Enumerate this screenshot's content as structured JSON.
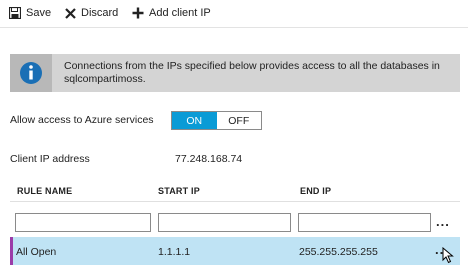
{
  "toolbar": {
    "save_label": "Save",
    "discard_label": "Discard",
    "add_client_ip_label": "Add client IP"
  },
  "info": {
    "text": "Connections from the IPs specified below provides access to all the databases in sqlcompartimoss.",
    "icon": "info-icon"
  },
  "azure_access": {
    "label": "Allow access to Azure services",
    "on_label": "ON",
    "off_label": "OFF",
    "selected": "ON"
  },
  "client_ip": {
    "label": "Client IP address",
    "value": "77.248.168.74"
  },
  "table": {
    "headers": [
      "RULE NAME",
      "START IP",
      "END IP"
    ],
    "new_rule": {
      "rule_name": "",
      "start_ip": "",
      "end_ip": "",
      "more_label": "..."
    },
    "rows": [
      {
        "rule_name": "All Open",
        "start_ip": "1.1.1.1",
        "end_ip": "255.255.255.255",
        "more_label": "..."
      }
    ]
  },
  "colors": {
    "accent": "#0a9bd6",
    "row_selected": "#bfe3f4",
    "row_marker": "#9b3ca8",
    "info_bg": "#d4d4d4",
    "info_icon": "#1a6fb5"
  }
}
